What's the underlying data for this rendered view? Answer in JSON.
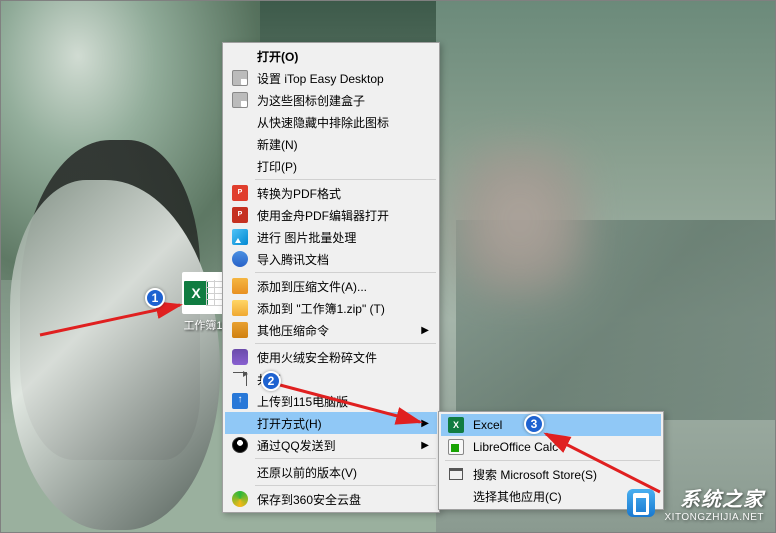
{
  "desktop_icon": {
    "label": "工作簿1",
    "badge_letter": "X"
  },
  "menu": {
    "open": "打开(O)",
    "itop": "设置 iTop Easy Desktop",
    "create_box": "为这些图标创建盒子",
    "exclude_hide": "从快速隐藏中排除此图标",
    "new": "新建(N)",
    "print": "打印(P)",
    "to_pdf": "转换为PDF格式",
    "jinzhou_pdf": "使用金舟PDF编辑器打开",
    "batch_image": "进行 图片批量处理",
    "tencent_doc": "导入腾讯文档",
    "add_zip_a": "添加到压缩文件(A)...",
    "add_zip_named": "添加到 \"工作簿1.zip\" (T)",
    "other_zip": "其他压缩命令",
    "huorong": "使用火绒安全粉碎文件",
    "share": "共享",
    "upload_115": "上传到115电脑版",
    "open_with": "打开方式(H)",
    "qq_send": "通过QQ发送到",
    "restore": "还原以前的版本(V)",
    "save_360": "保存到360安全云盘"
  },
  "submenu": {
    "excel": "Excel",
    "libreoffice": "LibreOffice Calc",
    "search_store": "搜索 Microsoft Store(S)",
    "choose_other": "选择其他应用(C)"
  },
  "badges": {
    "b1": "1",
    "b2": "2",
    "b3": "3"
  },
  "watermark": {
    "title": "系统之家",
    "url": "XITONGZHIJIA.NET"
  }
}
